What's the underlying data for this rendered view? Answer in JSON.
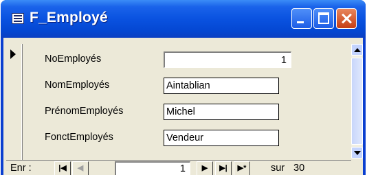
{
  "window": {
    "title": "F_Employé",
    "buttons": {
      "minimize": "minimize",
      "maximize": "maximize",
      "close": "close"
    }
  },
  "form": {
    "fields": [
      {
        "label": "NoEmployés",
        "value": "1"
      },
      {
        "label": "NomEmployés",
        "value": "Aintablian"
      },
      {
        "label": "PrénomEmployés",
        "value": "Michel"
      },
      {
        "label": "FonctEmployés",
        "value": "Vendeur"
      }
    ]
  },
  "navigation": {
    "label": "Enr :",
    "first_icon": "first-record-icon",
    "prev_icon": "previous-record-icon",
    "next_icon": "next-record-icon",
    "last_icon": "last-record-icon",
    "new_icon": "new-record-icon",
    "current_record": "1",
    "of_label": "sur",
    "total_records": "30"
  }
}
